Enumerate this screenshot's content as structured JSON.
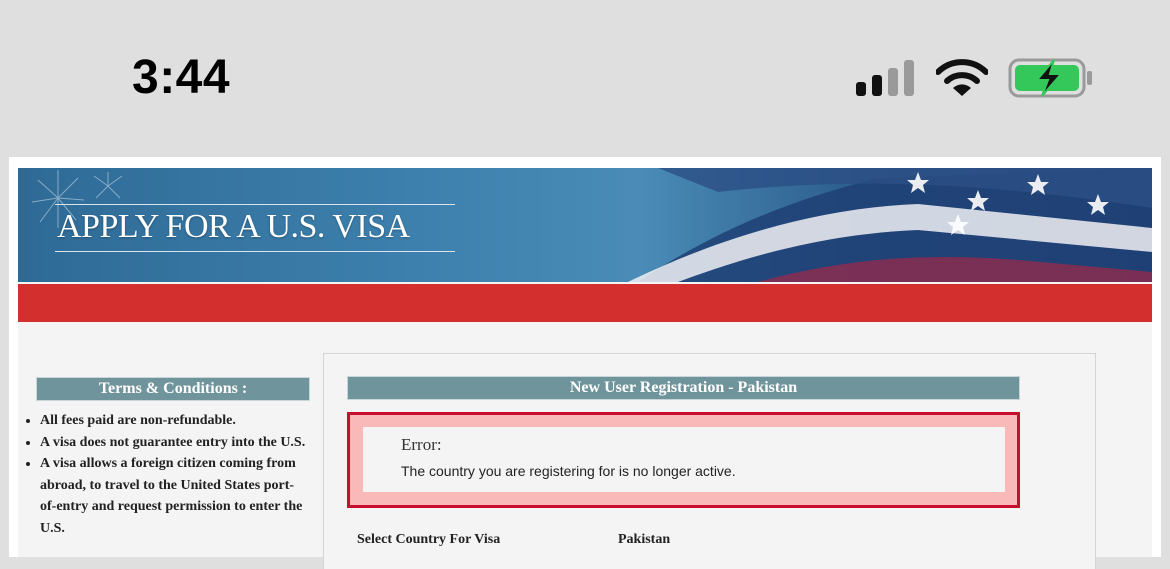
{
  "status_bar": {
    "time": "3:44",
    "signal_icon": "cellular-signal-icon",
    "wifi_icon": "wifi-icon",
    "battery_icon": "battery-charging-icon",
    "battery_color": "#34c759"
  },
  "banner": {
    "title": "APPLY FOR A U.S. VISA",
    "accent_red": "#d32f2f"
  },
  "terms": {
    "heading": "Terms & Conditions :",
    "items": [
      "All fees paid are non-refundable.",
      "A visa does not guarantee entry into the U.S.",
      "A visa allows a foreign citizen coming from abroad, to travel to the United States port-of-entry and request permission to enter the U.S."
    ]
  },
  "registration": {
    "heading": "New User Registration - Pakistan",
    "error_title": "Error:",
    "error_message": "The country you are registering for is no longer active.",
    "country_label": "Select Country For Visa",
    "country_value": "Pakistan"
  }
}
